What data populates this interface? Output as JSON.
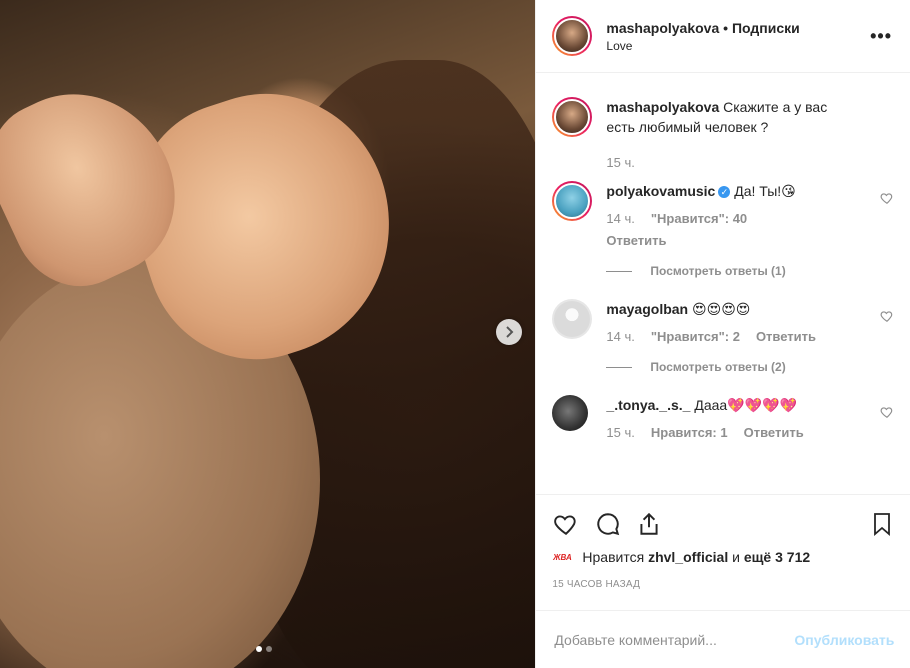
{
  "post": {
    "author": "mashapolyakova",
    "separator": "•",
    "follow_label": "Подписки",
    "location": "Love",
    "more_label": "•••"
  },
  "caption": {
    "user": "mashapolyakova",
    "text": "Скажите а у вас есть любимый человек ?",
    "time": "15 ч."
  },
  "comments": [
    {
      "user": "polyakovamusic",
      "text": "Да! Ты!😘",
      "time": "14 ч.",
      "likes": "\"Нравится\": 40",
      "reply": "Ответить",
      "view_replies": "Посмотреть ответы (1)",
      "verified": true
    },
    {
      "user": "mayagolban",
      "text": "😍😍😍😍",
      "time": "14 ч.",
      "likes": "\"Нравится\": 2",
      "reply": "Ответить",
      "view_replies": "Посмотреть ответы (2)"
    },
    {
      "user": "_.tonya._.s._",
      "text": "Дааа💖💖💖💖",
      "time": "15 ч.",
      "likes": "Нравится: 1",
      "reply": "Ответить"
    }
  ],
  "likes": {
    "badge": "ЖВА",
    "prefix": "Нравится",
    "user": "zhvl_official",
    "joiner": "и",
    "count": "ещё 3 712"
  },
  "timestamp": "15 ЧАСОВ НАЗАД",
  "comment_box": {
    "placeholder": "Добавьте комментарий...",
    "publish": "Опубликовать"
  },
  "carousel": {
    "current": 1,
    "total": 2
  },
  "colors": {
    "link": "#b2dffc",
    "verified": "#3897f0",
    "muted": "#8e8e8e"
  }
}
